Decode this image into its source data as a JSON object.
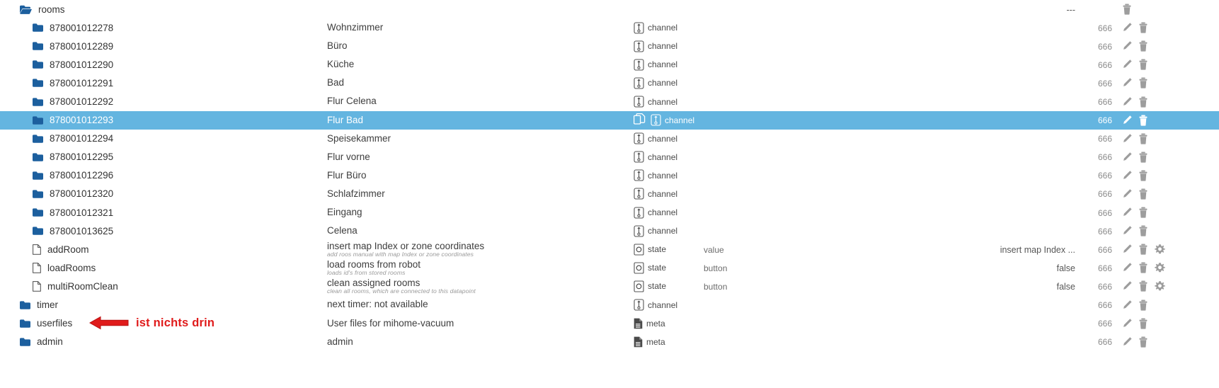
{
  "colors": {
    "selection": "#64b5e0",
    "folder": "#1c5f9e",
    "annotation": "#e01b1b",
    "muted": "#9a9a9a"
  },
  "annotation": {
    "text": "ist nichts drin",
    "arrow_icon": "left-arrow-icon"
  },
  "rows": [
    {
      "indent": 0,
      "icon": "folder-open-icon",
      "id": "rooms",
      "name": "",
      "sub": "",
      "type": "",
      "type_icon": "",
      "role": "",
      "value": "---",
      "perm": "",
      "actions": [
        "delete-icon"
      ]
    },
    {
      "indent": 1,
      "icon": "folder-icon",
      "id": "878001012278",
      "name": "Wohnzimmer",
      "sub": "",
      "type": "channel",
      "type_icon": "channel-icon",
      "role": "",
      "value": "",
      "perm": "666",
      "actions": [
        "edit-icon",
        "delete-icon"
      ]
    },
    {
      "indent": 1,
      "icon": "folder-icon",
      "id": "878001012289",
      "name": "Büro",
      "sub": "",
      "type": "channel",
      "type_icon": "channel-icon",
      "role": "",
      "value": "",
      "perm": "666",
      "actions": [
        "edit-icon",
        "delete-icon"
      ]
    },
    {
      "indent": 1,
      "icon": "folder-icon",
      "id": "878001012290",
      "name": "Küche",
      "sub": "",
      "type": "channel",
      "type_icon": "channel-icon",
      "role": "",
      "value": "",
      "perm": "666",
      "actions": [
        "edit-icon",
        "delete-icon"
      ]
    },
    {
      "indent": 1,
      "icon": "folder-icon",
      "id": "878001012291",
      "name": "Bad",
      "sub": "",
      "type": "channel",
      "type_icon": "channel-icon",
      "role": "",
      "value": "",
      "perm": "666",
      "actions": [
        "edit-icon",
        "delete-icon"
      ]
    },
    {
      "indent": 1,
      "icon": "folder-icon",
      "id": "878001012292",
      "name": "Flur Celena",
      "sub": "",
      "type": "channel",
      "type_icon": "channel-icon",
      "role": "",
      "value": "",
      "perm": "666",
      "actions": [
        "edit-icon",
        "delete-icon"
      ]
    },
    {
      "indent": 1,
      "icon": "folder-icon",
      "id": "878001012293",
      "name": "Flur Bad",
      "sub": "",
      "type": "channel",
      "type_icon": "channel-icon",
      "role": "",
      "value": "",
      "perm": "666",
      "selected": true,
      "copy": true,
      "actions": [
        "edit-icon",
        "delete-icon"
      ]
    },
    {
      "indent": 1,
      "icon": "folder-icon",
      "id": "878001012294",
      "name": "Speisekammer",
      "sub": "",
      "type": "channel",
      "type_icon": "channel-icon",
      "role": "",
      "value": "",
      "perm": "666",
      "actions": [
        "edit-icon",
        "delete-icon"
      ]
    },
    {
      "indent": 1,
      "icon": "folder-icon",
      "id": "878001012295",
      "name": "Flur vorne",
      "sub": "",
      "type": "channel",
      "type_icon": "channel-icon",
      "role": "",
      "value": "",
      "perm": "666",
      "actions": [
        "edit-icon",
        "delete-icon"
      ]
    },
    {
      "indent": 1,
      "icon": "folder-icon",
      "id": "878001012296",
      "name": "Flur Büro",
      "sub": "",
      "type": "channel",
      "type_icon": "channel-icon",
      "role": "",
      "value": "",
      "perm": "666",
      "actions": [
        "edit-icon",
        "delete-icon"
      ]
    },
    {
      "indent": 1,
      "icon": "folder-icon",
      "id": "878001012320",
      "name": "Schlafzimmer",
      "sub": "",
      "type": "channel",
      "type_icon": "channel-icon",
      "role": "",
      "value": "",
      "perm": "666",
      "actions": [
        "edit-icon",
        "delete-icon"
      ]
    },
    {
      "indent": 1,
      "icon": "folder-icon",
      "id": "878001012321",
      "name": "Eingang",
      "sub": "",
      "type": "channel",
      "type_icon": "channel-icon",
      "role": "",
      "value": "",
      "perm": "666",
      "actions": [
        "edit-icon",
        "delete-icon"
      ]
    },
    {
      "indent": 1,
      "icon": "folder-icon",
      "id": "878001013625",
      "name": "Celena",
      "sub": "",
      "type": "channel",
      "type_icon": "channel-icon",
      "role": "",
      "value": "",
      "perm": "666",
      "actions": [
        "edit-icon",
        "delete-icon"
      ]
    },
    {
      "indent": 1,
      "icon": "file-icon",
      "id": "addRoom",
      "name": "insert map Index or zone coordinates",
      "sub": "add roos manual with map Index or zone coordinates",
      "type": "state",
      "type_icon": "state-icon",
      "role": "value",
      "value": "insert map Index ...",
      "perm": "666",
      "actions": [
        "edit-icon",
        "delete-icon",
        "gear-icon"
      ]
    },
    {
      "indent": 1,
      "icon": "file-icon",
      "id": "loadRooms",
      "name": "load rooms from robot",
      "sub": "loads id's from stored rooms",
      "type": "state",
      "type_icon": "state-icon",
      "role": "button",
      "value": "false",
      "perm": "666",
      "actions": [
        "edit-icon",
        "delete-icon",
        "gear-icon"
      ]
    },
    {
      "indent": 1,
      "icon": "file-icon",
      "id": "multiRoomClean",
      "name": "clean assigned rooms",
      "sub": "clean all rooms, which are connected to this datapoint",
      "type": "state",
      "type_icon": "state-icon",
      "role": "button",
      "value": "false",
      "perm": "666",
      "actions": [
        "edit-icon",
        "delete-icon",
        "gear-icon"
      ]
    },
    {
      "indent": 0,
      "icon": "folder-icon",
      "id": "timer",
      "name": "next timer: not available",
      "sub": "",
      "type": "channel",
      "type_icon": "channel-icon",
      "role": "",
      "value": "",
      "perm": "666",
      "actions": [
        "edit-icon",
        "delete-icon"
      ]
    },
    {
      "indent": 0,
      "icon": "folder-icon",
      "id": "userfiles",
      "name": "User files for mihome-vacuum",
      "sub": "",
      "type": "meta",
      "type_icon": "meta-icon",
      "role": "",
      "value": "",
      "perm": "666",
      "actions": [
        "edit-icon",
        "delete-icon"
      ],
      "annotated": true
    },
    {
      "indent": 0,
      "icon": "folder-icon",
      "id": "admin",
      "name": "admin",
      "sub": "",
      "type": "meta",
      "type_icon": "meta-icon",
      "role": "",
      "value": "",
      "perm": "666",
      "actions": [
        "edit-icon",
        "delete-icon"
      ]
    }
  ]
}
